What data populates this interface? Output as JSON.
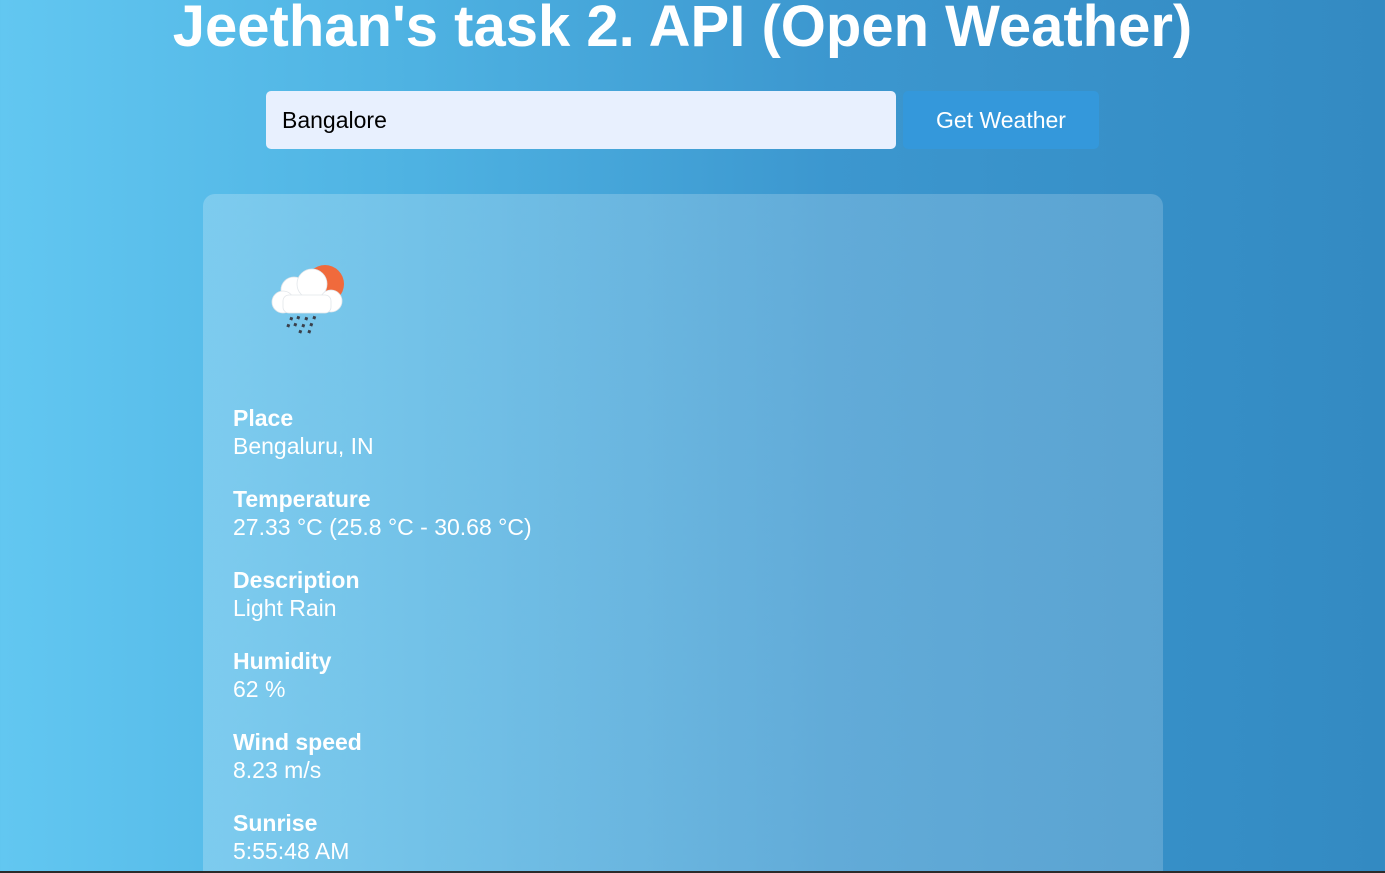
{
  "header": {
    "title": "Jeethan's task 2. API (Open Weather)"
  },
  "search": {
    "value": "Bangalore",
    "button_label": "Get Weather"
  },
  "weather": {
    "icon": "cloud-sun-rain-icon",
    "details": [
      {
        "label": "Place",
        "value": "Bengaluru, IN"
      },
      {
        "label": "Temperature",
        "value": "27.33 °C (25.8 °C - 30.68 °C)"
      },
      {
        "label": "Description",
        "value": "Light Rain"
      },
      {
        "label": "Humidity",
        "value": "62 %"
      },
      {
        "label": "Wind speed",
        "value": "8.23 m/s"
      },
      {
        "label": "Sunrise",
        "value": "5:55:48 AM"
      }
    ]
  },
  "colors": {
    "button": "#3498db",
    "input_bg": "#e8f0fe",
    "sun": "#f06a3c"
  }
}
